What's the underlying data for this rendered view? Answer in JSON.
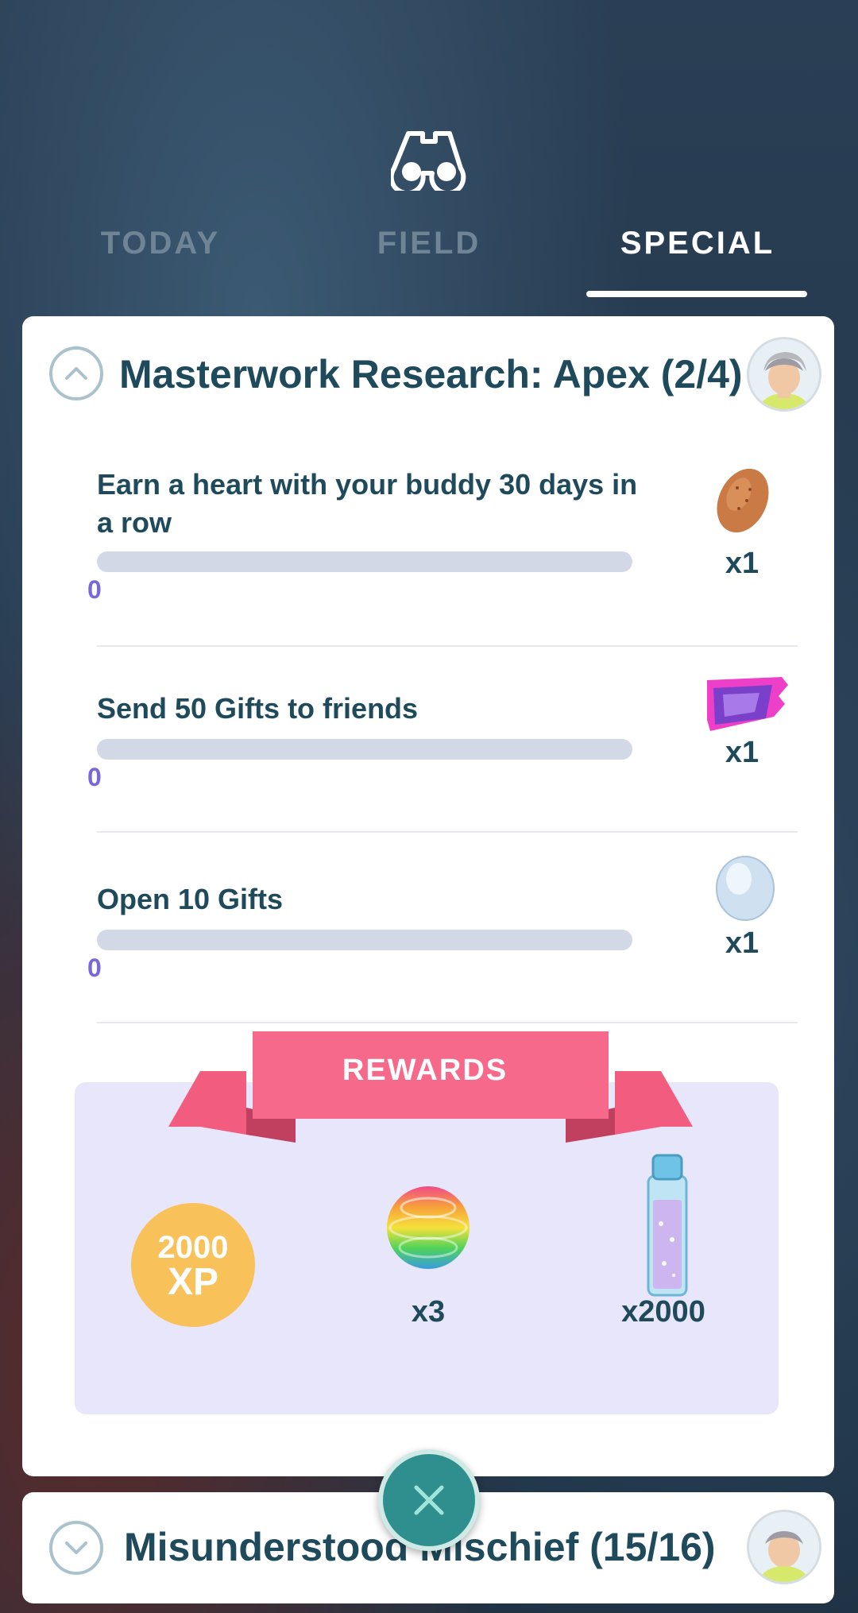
{
  "tabs": [
    {
      "label": "TODAY",
      "active": false
    },
    {
      "label": "FIELD",
      "active": false
    },
    {
      "label": "SPECIAL",
      "active": true
    }
  ],
  "header_icon": "binoculars-icon",
  "research_card": {
    "title": "Masterwork Research: Apex (2/4)",
    "expanded": true,
    "tasks": [
      {
        "text": "Earn a heart with your buddy 30 days in a row",
        "progress": "0",
        "progress_fraction": 0,
        "reward_icon": "pokemon-treat-icon",
        "reward_qty": "x1"
      },
      {
        "text": "Send 50 Gifts to friends",
        "progress": "0",
        "progress_fraction": 0,
        "reward_icon": "sticker-icon",
        "reward_qty": "x1"
      },
      {
        "text": "Open 10 Gifts",
        "progress": "0",
        "progress_fraction": 0,
        "reward_icon": "egg-icon",
        "reward_qty": "x1"
      }
    ],
    "rewards": {
      "label": "REWARDS",
      "items": [
        {
          "icon": "xp-badge",
          "amount": "2000",
          "unit": "XP",
          "qty": ""
        },
        {
          "icon": "rare-candy-icon",
          "qty": "x3"
        },
        {
          "icon": "stardust-tube-icon",
          "qty": "x2000"
        }
      ]
    }
  },
  "second_card": {
    "title": "Misunderstood Mischief (15/16)",
    "expanded": false
  },
  "colors": {
    "title_text": "#1f4a5c",
    "progress_text": "#7a68d8",
    "ribbon": "#f7698a",
    "rewards_bg": "#e8e6fa",
    "xp_badge": "#f8c15a",
    "close_button": "#2f8f8f"
  }
}
